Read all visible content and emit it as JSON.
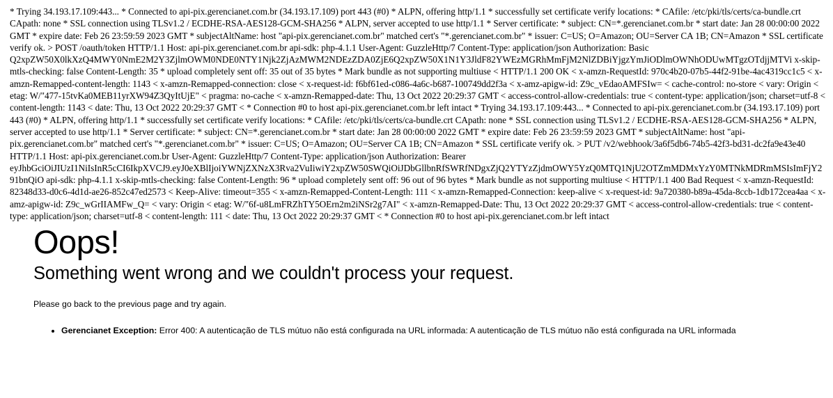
{
  "page": {
    "background_color": "#ffffff",
    "text_color": "#000000"
  },
  "debug_dump": {
    "label": "curl-verbose-output",
    "text": "* Trying 34.193.17.109:443... * Connected to api-pix.gerencianet.com.br (34.193.17.109) port 443 (#0) * ALPN, offering http/1.1 * successfully set certificate verify locations: * CAfile: /etc/pki/tls/certs/ca-bundle.crt CApath: none * SSL connection using TLSv1.2 / ECDHE-RSA-AES128-GCM-SHA256 * ALPN, server accepted to use http/1.1 * Server certificate: * subject: CN=*.gerencianet.com.br * start date: Jan 28 00:00:00 2022 GMT * expire date: Feb 26 23:59:59 2023 GMT * subjectAltName: host \"api-pix.gerencianet.com.br\" matched cert's \"*.gerencianet.com.br\" * issuer: C=US; O=Amazon; OU=Server CA 1B; CN=Amazon * SSL certificate verify ok. > POST /oauth/token HTTP/1.1 Host: api-pix.gerencianet.com.br api-sdk: php-4.1.1 User-Agent: GuzzleHttp/7 Content-Type: application/json Authorization: Basic Q2xpZW50X0lkXzQ4MWY0NmE2M2Y3ZjlmOWM0NDE0NTY1Njk2ZjAzMWM2NDEzZDA0ZjE6Q2xpZW50X1N1Y3JldF82YWEzMGRhMmFjM2NlZDBiYjgzYmJiODlmOWNhODUwMTgzOTdjjMTVi x-skip-mtls-checking: false Content-Length: 35 * upload completely sent off: 35 out of 35 bytes * Mark bundle as not supporting multiuse < HTTP/1.1 200 OK < x-amzn-RequestId: 970c4b20-07b5-44f2-91be-4ac4319cc1c5 < x-amzn-Remapped-content-length: 1143 < x-amzn-Remapped-connection: close < x-request-id: f6bf61ed-c086-4a6c-b687-100749dd2f3a < x-amz-apigw-id: Z9c_vEdaoAMFSIw= < cache-control: no-store < vary: Origin < etag: W/\"477-15tvKa0MEB11yrXW94Z3QyItUjE\" < pragma: no-cache < x-amzn-Remapped-date: Thu, 13 Oct 2022 20:29:37 GMT < access-control-allow-credentials: true < content-type: application/json; charset=utf-8 < content-length: 1143 < date: Thu, 13 Oct 2022 20:29:37 GMT < * Connection #0 to host api-pix.gerencianet.com.br left intact * Trying 34.193.17.109:443... * Connected to api-pix.gerencianet.com.br (34.193.17.109) port 443 (#0) * ALPN, offering http/1.1 * successfully set certificate verify locations: * CAfile: /etc/pki/tls/certs/ca-bundle.crt CApath: none * SSL connection using TLSv1.2 / ECDHE-RSA-AES128-GCM-SHA256 * ALPN, server accepted to use http/1.1 * Server certificate: * subject: CN=*.gerencianet.com.br * start date: Jan 28 00:00:00 2022 GMT * expire date: Feb 26 23:59:59 2023 GMT * subjectAltName: host \"api-pix.gerencianet.com.br\" matched cert's \"*.gerencianet.com.br\" * issuer: C=US; O=Amazon; OU=Server CA 1B; CN=Amazon * SSL certificate verify ok. > PUT /v2/webhook/3a6f5db6-74b5-42f3-bd31-dc2fa9e43e40 HTTP/1.1 Host: api-pix.gerencianet.com.br User-Agent: GuzzleHttp/7 Content-Type: application/json Authorization: Bearer eyJhbGciOiJIUzI1NiIsInR5cCI6IkpXVCJ9.eyJ0eXBlIjoiYWNjZXNzX3Rva2VuIiwiY2xpZW50SWQiOiJDbGllbnRfSWRfNDgxZjQ2YTYzZjdmOWY5YzQ0MTQ1NjU2OTZmMDMxYzY0MTNkMDRmMSIsImFjY291bnQiO",
    "text_continued": "api-sdk: php-4.1.1 x-skip-mtls-checking: false Content-Length: 96 * upload completely sent off: 96 out of 96 bytes * Mark bundle as not supporting multiuse < HTTP/1.1 400 Bad Request < x-amzn-RequestId: 82348d33-d0c6-4d1d-ae26-852c47ed2573 < Keep-Alive: timeout=355 < x-amzn-Remapped-Content-Length: 111 < x-amzn-Remapped-Connection: keep-alive < x-request-id: 9a720380-b89a-45da-8ccb-1db172cea4aa < x-amz-apigw-id: Z9c_wGrIIAMFw_Q= < vary: Origin < etag: W/\"6f-u8LmFRZhTY5OErn2m2iNSr2g7AI\" < x-amzn-Remapped-Date: Thu, 13 Oct 2022 20:29:37 GMT < access-control-allow-credentials: true < content-type: application/json; charset=utf-8 < content-length: 111 < date: Thu, 13 Oct 2022 20:29:37 GMT < * Connection #0 to host api-pix.gerencianet.com.br left intact"
  },
  "error": {
    "heading": "Oops!",
    "subheading": "Something went wrong and we couldn't process your request.",
    "hint": "Please go back to the previous page and try again.",
    "items": [
      {
        "name": "Gerencianet Exception:",
        "message": " Error 400: A autenticação de TLS mútuo não está configurada na URL informada: A autenticação de TLS mútuo não está configurada na URL informada"
      }
    ]
  }
}
